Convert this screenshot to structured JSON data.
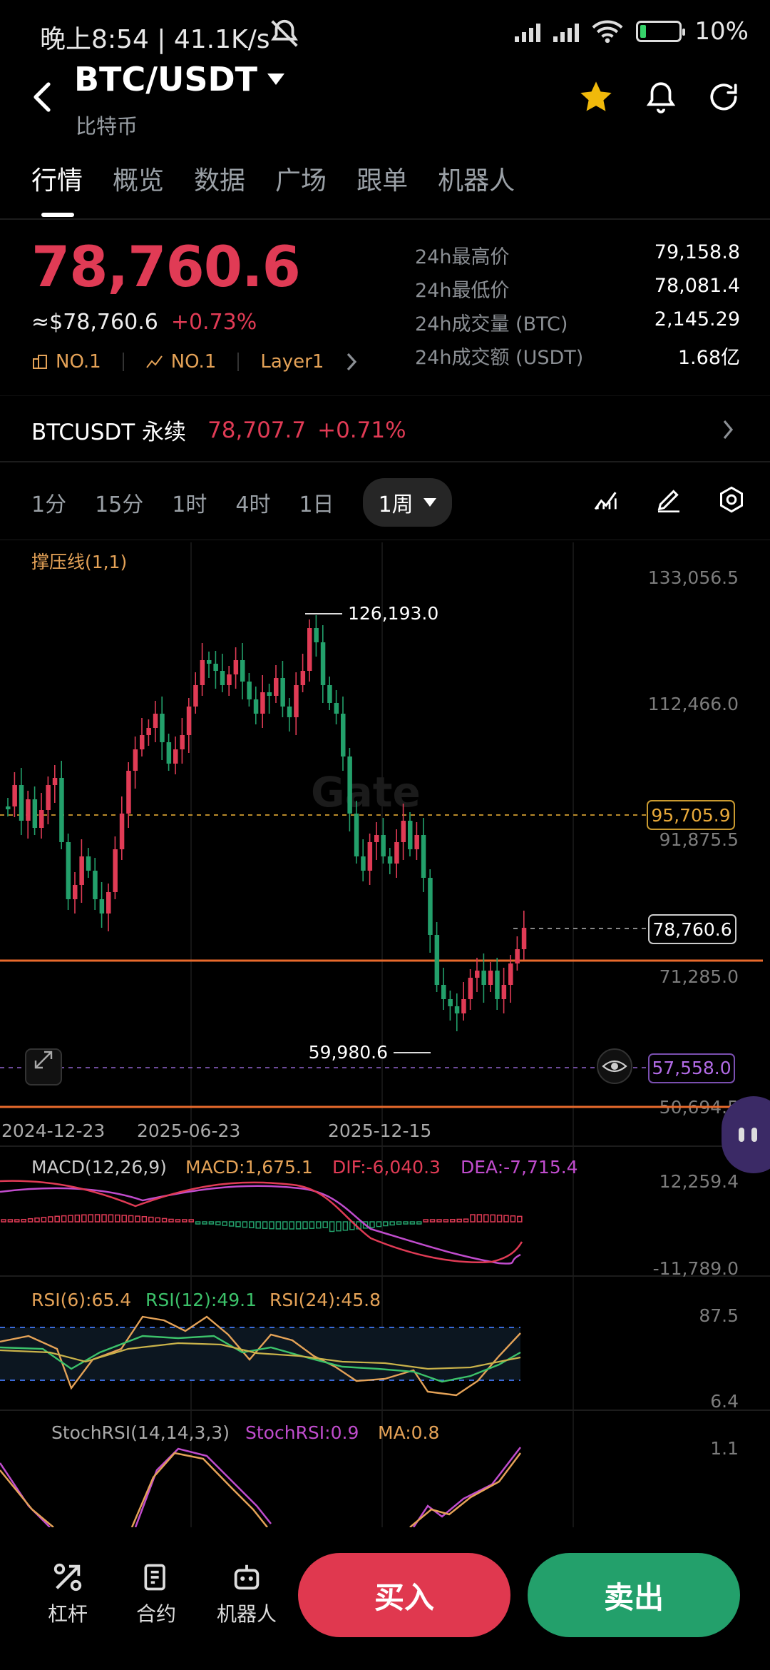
{
  "status": {
    "time": "晚上8:54 | 41.1K/s",
    "battery": "10%"
  },
  "header": {
    "pair": "BTC/USDT",
    "name": "比特币"
  },
  "tabs": [
    "行情",
    "概览",
    "数据",
    "广场",
    "跟单",
    "机器人"
  ],
  "ticker": {
    "price": "78,760.6",
    "usd": "≈$78,760.6",
    "change": "+0.73%",
    "rank1": "NO.1",
    "rank2": "NO.1",
    "tag": "Layer1"
  },
  "stats": [
    {
      "k": "24h最高价",
      "v": "79,158.8"
    },
    {
      "k": "24h最低价",
      "v": "78,081.4"
    },
    {
      "k": "24h成交量 (BTC)",
      "v": "2,145.29"
    },
    {
      "k": "24h成交额 (USDT)",
      "v": "1.68亿"
    }
  ],
  "perpetual": {
    "name": "BTCUSDT 永续",
    "price": "78,707.7",
    "change": "+0.71%"
  },
  "periods": [
    "1分",
    "15分",
    "1时",
    "4时",
    "1日"
  ],
  "active_period": "1周",
  "chart": {
    "indicator": "撑压线(1,1)",
    "watermark": "Gate",
    "y_ticks": [
      "133,056.5",
      "112,466.0",
      "91,875.5",
      "71,285.0",
      "50,694.5"
    ],
    "high_label": "126,193.0",
    "low_label": "59,980.6",
    "resistance": "95,705.9",
    "current": "78,760.6",
    "lower": "57,558.0",
    "dates": [
      "2024-12-23",
      "2025-06-23",
      "2025-12-15"
    ],
    "colors": {
      "up": "#e03b55",
      "down": "#23a06b",
      "line": "#e86a2c"
    }
  },
  "macd": {
    "title": "MACD(12,26,9)",
    "macd": "MACD:1,675.1",
    "dif": "DIF:-6,040.3",
    "dea": "DEA:-7,715.4",
    "top": "12,259.4",
    "bottom": "-11,789.0"
  },
  "rsi": {
    "r6": "RSI(6):65.4",
    "r12": "RSI(12):49.1",
    "r24": "RSI(24):45.8",
    "top": "87.5",
    "bottom": "6.4"
  },
  "stoch": {
    "title": "StochRSI(14,14,3,3)",
    "val": "StochRSI:0.9",
    "ma": "MA:0.8",
    "top": "1.1"
  },
  "bottom": {
    "leverage": "杠杆",
    "contract": "合约",
    "bot": "机器人",
    "buy": "买入",
    "sell": "卖出"
  }
}
